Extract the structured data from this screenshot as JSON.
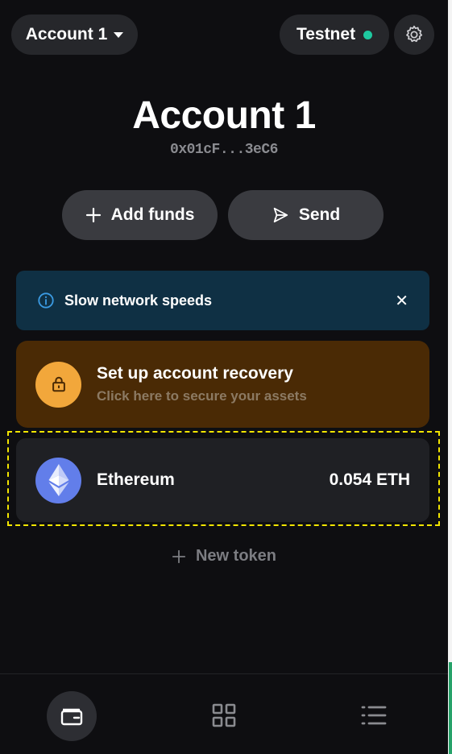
{
  "header": {
    "account_label": "Account 1",
    "network_label": "Testnet",
    "network_status_color": "#1ec9a0"
  },
  "account": {
    "name": "Account 1",
    "address": "0x01cF...3eC6"
  },
  "actions": {
    "add_funds_label": "Add funds",
    "send_label": "Send"
  },
  "alert": {
    "message": "Slow network speeds",
    "close_glyph": "✕"
  },
  "recovery": {
    "title": "Set up account recovery",
    "subtitle": "Click here to secure your assets"
  },
  "tokens": [
    {
      "name": "Ethereum",
      "balance": "0.054 ETH",
      "icon": "ethereum-icon"
    }
  ],
  "new_token_label": "New token",
  "colors": {
    "background": "#0e0e11",
    "alert_bg": "#0f3044",
    "recovery_bg": "#4a2a05",
    "lock_accent": "#f2a73b",
    "eth_accent": "#627eea",
    "highlight": "#f3e600"
  },
  "nav": [
    {
      "icon": "wallet-icon"
    },
    {
      "icon": "apps-grid-icon"
    },
    {
      "icon": "activity-list-icon"
    }
  ]
}
